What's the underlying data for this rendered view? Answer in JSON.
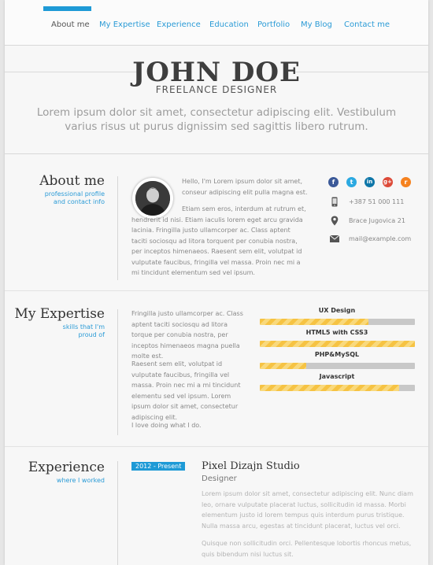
{
  "nav": {
    "items": [
      "About me",
      "My Expertise",
      "Experience",
      "Education",
      "Portfolio",
      "My Blog",
      "Contact me"
    ],
    "active": "About me"
  },
  "header": {
    "name": "JOHN DOE",
    "title": "FREELANCE DESIGNER",
    "tagline": "Lorem ipsum dolor sit amet, consectetur adipiscing elit. Vestibulum varius risus ut purus dignissim sed sagittis libero rutrum."
  },
  "about": {
    "title": "About me",
    "subtitle_line1": "professional profile",
    "subtitle_line2": "and contact info",
    "para1": "Hello, I'm Lorem ipsum dolor sit amet, conseur adipiscing elit pulla magna est.",
    "para2": "Etiam sem eros, interdum at rutrum et, hendrerit id nisi. Etiam iaculis lorem eget arcu gravida lacinia. Fringilla justo ullamcorper ac. Class aptent taciti sociosqu ad litora torquent per conubia nostra, per inceptos himenaeos. Raesent sem elit, volutpat id vulputate faucibus, fringilla vel massa. Proin nec mi a mi tincidunt elementum sed vel ipsum.",
    "social": [
      {
        "icon": "facebook-icon",
        "glyph": "f",
        "color": "#3b5998"
      },
      {
        "icon": "twitter-icon",
        "glyph": "t",
        "color": "#2ba9e1"
      },
      {
        "icon": "linkedin-icon",
        "glyph": "in",
        "color": "#0e76a8"
      },
      {
        "icon": "googleplus-icon",
        "glyph": "g+",
        "color": "#dd4b39"
      },
      {
        "icon": "rss-icon",
        "glyph": "r",
        "color": "#f5821f"
      }
    ],
    "phone": "+387 51 000 111",
    "address": "Brace Jugovica 21",
    "email": "mail@example.com"
  },
  "expertise": {
    "title": "My Expertise",
    "subtitle_line1": "skills that I'm",
    "subtitle_line2": "proud of",
    "para1": "Fringilla justo ullamcorper ac. Class aptent taciti sociosqu ad litora torque per conubia nostra, per inceptos himenaeos magna puella molte est.",
    "para2": "Raesent sem elit, volutpat id vulputate faucibus, fringilla vel massa. Proin nec mi a mi tincidunt elementu sed vel ipsum. Lorem ipsum dolor sit amet, consectetur adipiscing elit.",
    "para3": "I love doing what I do.",
    "skills": [
      {
        "label": "UX Design",
        "level": 0.7
      },
      {
        "label": "HTML5 with CSS3",
        "level": 1.0
      },
      {
        "label": "PHP&MySQL",
        "level": 0.3
      },
      {
        "label": "Javascript",
        "level": 0.9
      }
    ]
  },
  "experience": {
    "title": "Experience",
    "subtitle": "where I worked",
    "badge": "2012 - Present",
    "company": "Pixel Dizajn Studio",
    "role": "Designer",
    "para1": "Lorem ipsum dolor sit amet, consectetur adipiscing elit. Nunc diam leo, ornare vulputate placerat luctus, sollicitudin id massa. Morbi elementum justo id lorem tempus quis interdum purus tristique. Nulla massa arcu, egestas at tincidunt placerat, luctus vel orci.",
    "para2": "Quisque non sollicitudin orci. Pellentesque lobortis rhoncus metus, quis bibendum nisi luctus sit."
  }
}
